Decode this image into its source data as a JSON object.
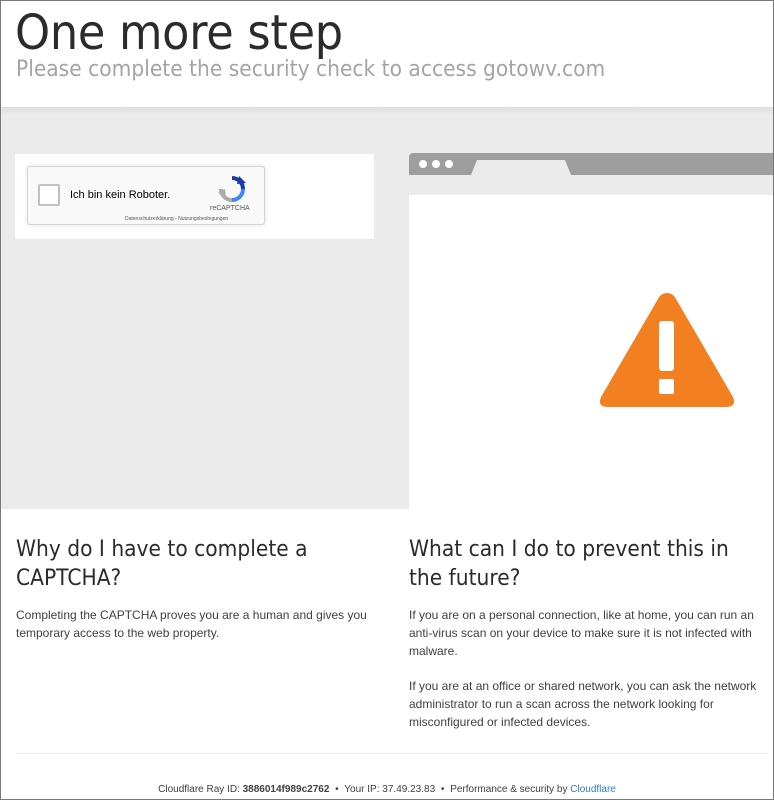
{
  "header": {
    "title": "One more step",
    "subtitle": "Please complete the security check to access gotowv.com"
  },
  "captcha": {
    "label": "Ich bin kein Roboter.",
    "brand": "reCAPTCHA",
    "privacy_link": "Datenschutzerklärung",
    "link_separator": " - ",
    "terms_link": "Nutzungsbedingungen"
  },
  "illustration": {
    "icon": "warning-triangle-icon",
    "icon_color": "#f38020",
    "browser_bar_color": "#9e9e9e"
  },
  "why": {
    "heading": "Why do I have to complete a CAPTCHA?",
    "body": "Completing the CAPTCHA proves you are a human and gives you temporary access to the web property."
  },
  "prevent": {
    "heading": "What can I do to prevent this in the future?",
    "body1": "If you are on a personal connection, like at home, you can run an anti-virus scan on your device to make sure it is not infected with malware.",
    "body2": "If you are at an office or shared network, you can ask the network administrator to run a scan across the network looking for misconfigured or infected devices."
  },
  "footer": {
    "ray_label": "Cloudflare Ray ID: ",
    "ray_id": "3886014f989c2762",
    "bullet": "•",
    "ip_label": "Your IP: ",
    "ip": "37.49.23.83",
    "perf_label": "Performance & security by ",
    "cf_link": "Cloudflare"
  },
  "colors": {
    "accent_link": "#2f7bbf",
    "warning": "#f38020"
  }
}
